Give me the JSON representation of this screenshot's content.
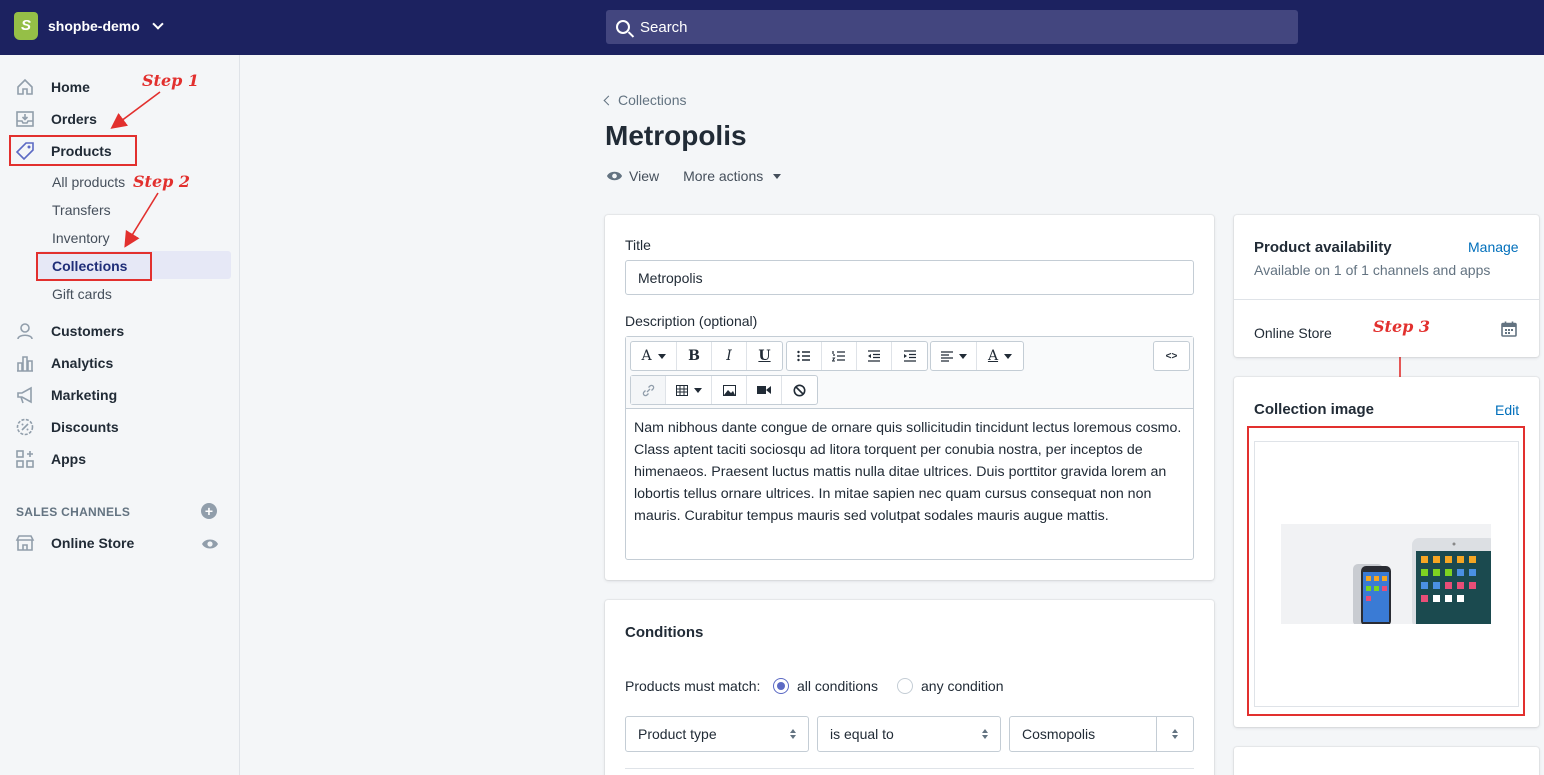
{
  "topbar": {
    "store_name": "shopbe-demo",
    "search_placeholder": "Search"
  },
  "sidebar": {
    "items": [
      {
        "label": "Home"
      },
      {
        "label": "Orders"
      },
      {
        "label": "Products"
      },
      {
        "label": "Customers"
      },
      {
        "label": "Analytics"
      },
      {
        "label": "Marketing"
      },
      {
        "label": "Discounts"
      },
      {
        "label": "Apps"
      }
    ],
    "sub_items": [
      "All products",
      "Transfers",
      "Inventory",
      "Collections",
      "Gift cards"
    ],
    "sales_channels_title": "SALES CHANNELS",
    "online_store": "Online Store"
  },
  "annotations": {
    "step1": "Step 1",
    "step2": "Step 2",
    "step3": "Step 3"
  },
  "page": {
    "breadcrumb": "Collections",
    "title": "Metropolis",
    "view_label": "View",
    "more_actions_label": "More actions"
  },
  "form": {
    "title_label": "Title",
    "title_value": "Metropolis",
    "description_label": "Description (optional)",
    "description_text": "Nam nibhous dante congue de ornare quis sollicitudin tincidunt lectus loremous cosmo. Class aptent taciti sociosqu ad litora torquent per conubia nostra, per inceptos de himenaeos. Praesent luctus mattis nulla ditae ultrices. Duis porttitor gravida lorem an lobortis tellus ornare ultrices. In mitae sapien nec quam cursus consequat non non mauris. Curabitur tempus mauris sed volutpat sodales mauris augue mattis.",
    "html_button": "<>"
  },
  "conditions": {
    "title": "Conditions",
    "match_label": "Products must match:",
    "option_all": "all conditions",
    "option_any": "any condition",
    "selected": "all conditions",
    "field": "Product type",
    "operator": "is equal to",
    "value": "Cosmopolis"
  },
  "availability": {
    "title": "Product availability",
    "manage_label": "Manage",
    "subtitle": "Available on 1 of 1 channels and apps",
    "channel": "Online Store"
  },
  "collection_image": {
    "title": "Collection image",
    "edit_label": "Edit"
  },
  "colors": {
    "topbar": "#1c2260",
    "accent": "#5c6ac4",
    "link": "#006fbb",
    "annotation": "#e2302e"
  }
}
